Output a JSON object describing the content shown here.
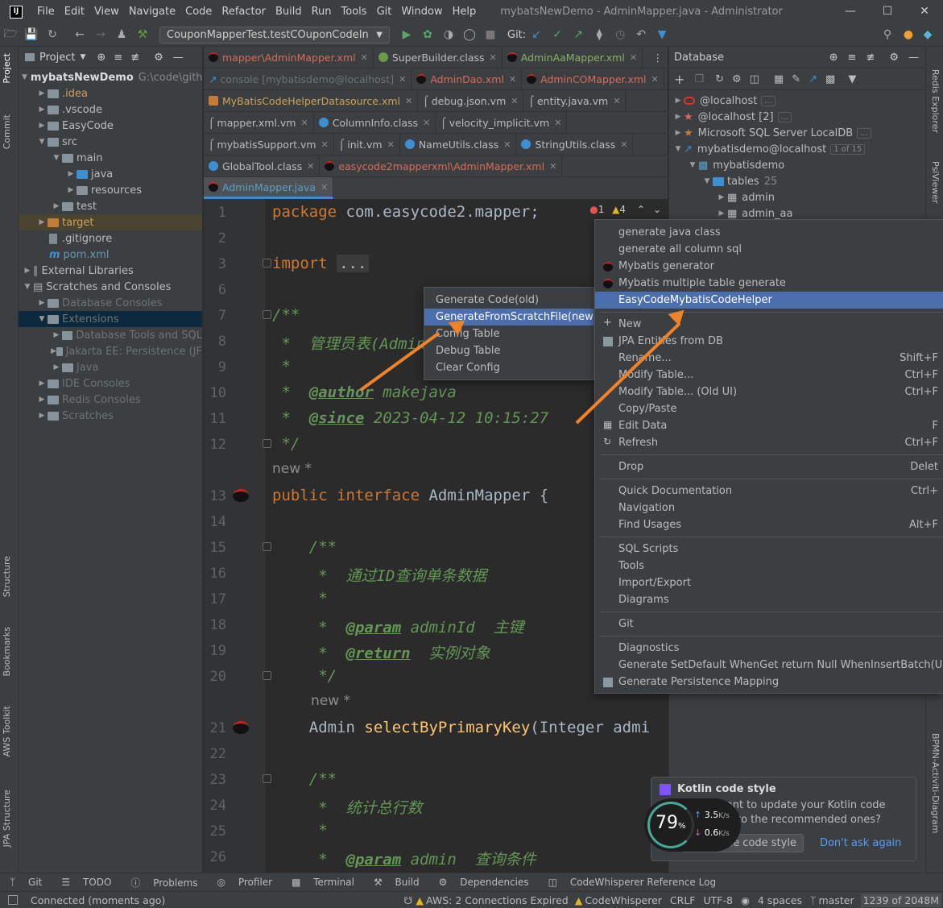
{
  "window": {
    "title": "mybatsNewDemo - AdminMapper.java - Administrator"
  },
  "menubar": [
    "File",
    "Edit",
    "View",
    "Navigate",
    "Code",
    "Refactor",
    "Build",
    "Run",
    "Tools",
    "Git",
    "Window",
    "Help"
  ],
  "toolbar": {
    "run_config": "CouponMapperTest.testCOuponCodeIn",
    "git_label": "Git:"
  },
  "left_stripe": {
    "project": "Project",
    "commit": "Commit",
    "structure": "Structure",
    "bookmarks": "Bookmarks",
    "aws": "AWS Toolkit",
    "jpa": "JPA Structure"
  },
  "right_stripe": {
    "redis": "Redis Explorer",
    "psi": "PsiViewer",
    "bpmn": "BPMN-Activiti-Diagram"
  },
  "project_panel": {
    "title": "Project",
    "tree": [
      {
        "label": "mybatsNewDemo",
        "path": "G:\\code\\gith"
      },
      {
        "label": ".idea"
      },
      {
        "label": ".vscode"
      },
      {
        "label": "EasyCode"
      },
      {
        "label": "src"
      },
      {
        "label": "main"
      },
      {
        "label": "java"
      },
      {
        "label": "resources"
      },
      {
        "label": "test"
      },
      {
        "label": "target"
      },
      {
        "label": ".gitignore"
      },
      {
        "label": "pom.xml"
      },
      {
        "label": "External Libraries"
      },
      {
        "label": "Scratches and Consoles"
      },
      {
        "label": "Database Consoles"
      },
      {
        "label": "Extensions"
      },
      {
        "label": "Database Tools and SQL"
      },
      {
        "label": "Jakarta EE: Persistence (JF"
      },
      {
        "label": "Java"
      },
      {
        "label": "IDE Consoles"
      },
      {
        "label": "Redis Consoles"
      },
      {
        "label": "Scratches"
      }
    ]
  },
  "editor_tabs": [
    [
      "mapper\\AdminMapper.xml",
      "SuperBuilder.class",
      "AdminAaMapper.xml"
    ],
    [
      "console [mybatisdemo@localhost]",
      "AdminDao.xml",
      "AdminCOMapper.xml"
    ],
    [
      "MyBatisCodeHelperDatasource.xml",
      "debug.json.vm",
      "entity.java.vm"
    ],
    [
      "mapper.xml.vm",
      "ColumnInfo.class",
      "velocity_implicit.vm"
    ],
    [
      "mybatisSupport.vm",
      "init.vm",
      "NameUtils.class",
      "StringUtils.class"
    ],
    [
      "GlobalTool.class",
      "easycode2mapperxml\\AdminMapper.xml"
    ],
    [
      "AdminMapper.java"
    ]
  ],
  "editor": {
    "inspections": {
      "errors": "1",
      "warnings": "4"
    },
    "line_numbers": [
      "1",
      "2",
      "3",
      "6",
      "7",
      "8",
      "9",
      "10",
      "11",
      "12",
      "13",
      "14",
      "15",
      "16",
      "17",
      "18",
      "19",
      "20",
      "21",
      "22",
      "23",
      "24",
      "25",
      "26"
    ],
    "code": {
      "l1a": "package",
      "l1b": " com.easycode2.mapper;",
      "l3a": "import",
      "l3b": "...",
      "l7": "/**",
      "l8": " *  管理员表(Admin",
      "l9": " *",
      "l10a": " *  ",
      "l10b": "@author",
      "l10c": " makejava",
      "l11a": " *  ",
      "l11b": "@since",
      "l11c": " 2023-04-12 10:15:27",
      "l12": " */",
      "hint1": "new *",
      "l13a": "public interface",
      "l13b": " AdminMapper {",
      "l15": "    /**",
      "l16": "     *  通过ID查询单条数据",
      "l17": "     *",
      "l18a": "     *  ",
      "l18b": "@param",
      "l18c": " adminId  主键",
      "l19a": "     *  ",
      "l19b": "@return",
      "l19c": "  实例对象",
      "l20": "     */",
      "hint2": "new *",
      "l21a": "    Admin ",
      "l21b": "selectByPrimaryKey",
      "l21c": "(Integer admi",
      "l23": "    /**",
      "l24": "     *  统计总行数",
      "l25": "     *",
      "l26a": "     *  ",
      "l26b": "@param",
      "l26c": " admin  查询条件"
    }
  },
  "database_panel": {
    "title": "Database",
    "nodes": [
      {
        "label": "@localhost"
      },
      {
        "label": "@localhost [2]"
      },
      {
        "label": "Microsoft SQL Server LocalDB"
      },
      {
        "label": "mybatisdemo@localhost",
        "badge": "1 of 15"
      },
      {
        "label": "mybatisdemo"
      },
      {
        "label": "tables",
        "count": "25"
      },
      {
        "label": "admin"
      },
      {
        "label": "admin_aa"
      }
    ]
  },
  "submenu": [
    "Generate Code(old)",
    "GenerateFromScratchFile(new)",
    "Config Table",
    "Debug Table",
    "Clear Config"
  ],
  "context_menu": {
    "top": [
      "generate java class",
      "generate all column sql",
      "Mybatis generator",
      "Mybatis multiple table generate",
      "EasyCodeMybatisCodeHelper"
    ],
    "items": [
      {
        "label": "New"
      },
      {
        "label": "JPA Entities from DB"
      },
      {
        "label": "Rename...",
        "shortcut": "Shift+F"
      },
      {
        "label": "Modify Table...",
        "shortcut": "Ctrl+F"
      },
      {
        "label": "Modify Table... (Old UI)",
        "shortcut": "Ctrl+F"
      },
      {
        "label": "Copy/Paste"
      },
      {
        "label": "Edit Data",
        "shortcut": "F"
      },
      {
        "label": "Refresh",
        "shortcut": "Ctrl+F"
      },
      {
        "label": "Drop",
        "shortcut": "Delet"
      },
      {
        "label": "Quick Documentation",
        "shortcut": "Ctrl+"
      },
      {
        "label": "Navigation"
      },
      {
        "label": "Find Usages",
        "shortcut": "Alt+F"
      },
      {
        "label": "SQL Scripts"
      },
      {
        "label": "Tools"
      },
      {
        "label": "Import/Export"
      },
      {
        "label": "Diagrams"
      },
      {
        "label": "Git"
      },
      {
        "label": "Diagnostics"
      },
      {
        "label": "Generate SetDefault WhenGet return Null WhenInsertBatch(Unstable)"
      },
      {
        "label": "Generate Persistence Mapping"
      }
    ]
  },
  "notification": {
    "title": "Kotlin code style",
    "line1": "Do you want to update your Kotlin code",
    "line2": "to the recommended ones?",
    "apply": "Apply the code style",
    "dismiss": "Don't ask again"
  },
  "speed_widget": {
    "percent": "79",
    "pct_sign": "%",
    "up": "3.5",
    "down": "0.6",
    "unit": "K/s"
  },
  "tool_windows": [
    "Git",
    "TODO",
    "Problems",
    "Profiler",
    "Terminal",
    "Build",
    "Dependencies",
    "CodeWhisperer Reference Log"
  ],
  "status_bar": {
    "message": "Connected (moments ago)",
    "aws": "AWS: 2 Connections Expired",
    "codewhisperer": "CodeWhisperer",
    "line_sep": "CRLF",
    "encoding": "UTF-8",
    "indent": "4 spaces",
    "branch": "master",
    "memory": "1239 of 2048M"
  },
  "colors": {
    "accent": "#4b6eaf",
    "arrow": "#f0832a",
    "keyword": "#cc7832",
    "comment": "#629755"
  }
}
